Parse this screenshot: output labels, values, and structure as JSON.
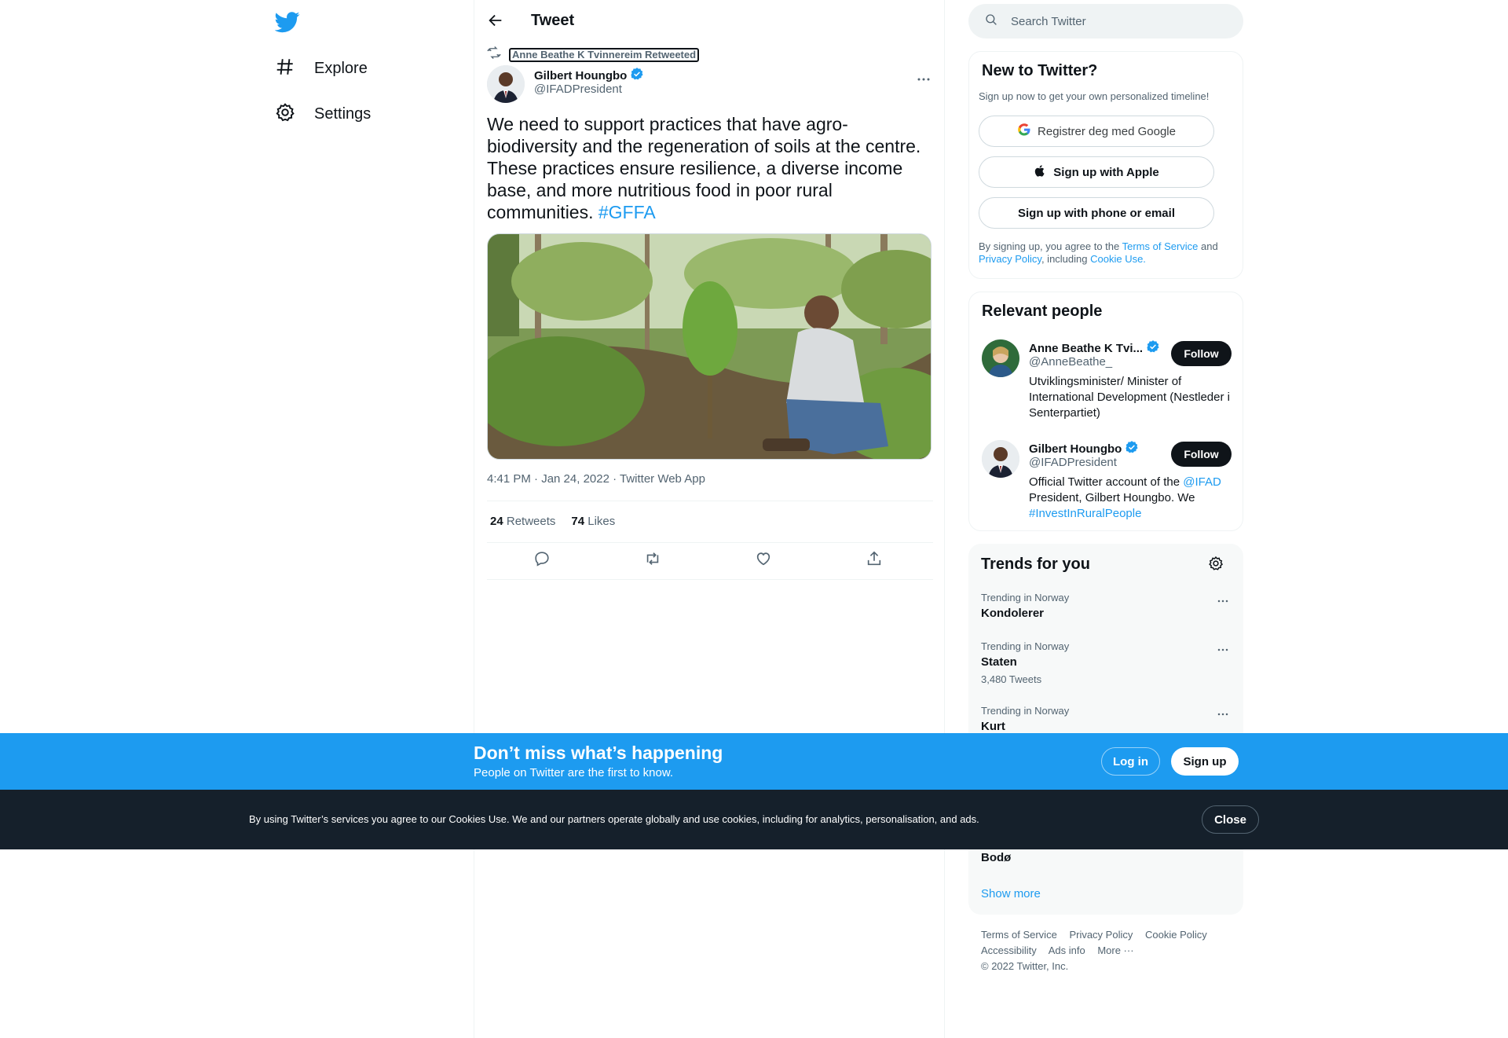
{
  "nav": {
    "items": [
      {
        "label": "Explore",
        "icon": "hashtag-icon"
      },
      {
        "label": "Settings",
        "icon": "gear-icon"
      }
    ]
  },
  "header": {
    "title": "Tweet"
  },
  "tweet": {
    "retweet_context": "Anne Beathe K Tvinnereim Retweeted",
    "author_name": "Gilbert Houngbo",
    "author_handle": "@IFADPresident",
    "text": "We need to support practices that have agro-biodiversity and the regeneration of soils at the centre. These practices ensure resilience, a diverse income base, and more nutritious food in poor rural communities.",
    "hashtag": "#GFFA",
    "meta": "4:41 PM · Jan 24, 2022 · Twitter Web App",
    "retweets_count": "24",
    "retweets_label": "Retweets",
    "likes_count": "74",
    "likes_label": "Likes"
  },
  "search": {
    "placeholder": "Search Twitter"
  },
  "new_to_twitter": {
    "title": "New to Twitter?",
    "subtitle": "Sign up now to get your own personalized timeline!",
    "google_label": "Registrer deg med Google",
    "apple_label": "Sign up with Apple",
    "phone_label": "Sign up with phone or email",
    "legal_prefix": "By signing up, you agree to the ",
    "terms": "Terms of Service",
    "and": " and ",
    "privacy": "Privacy Policy",
    "including": ", including ",
    "cookie": "Cookie Use."
  },
  "relevant": {
    "title": "Relevant people",
    "people": [
      {
        "name": "Anne Beathe K Tvi...",
        "handle": "@AnneBeathe_",
        "bio": "Utviklingsminister/ Minister of International Development (Nestleder i Senterpartiet)",
        "follow": "Follow"
      },
      {
        "name": "Gilbert Houngbo",
        "handle": "@IFADPresident",
        "bio_prefix": "Official Twitter account of the ",
        "bio_link": "@IFAD",
        "bio_middle": " President, Gilbert Houngbo. We ",
        "bio_tag": "#InvestInRuralPeople",
        "follow": "Follow"
      }
    ]
  },
  "trends": {
    "title": "Trends for you",
    "items": [
      {
        "category": "Trending in Norway",
        "name": "Kondolerer",
        "count": ""
      },
      {
        "category": "Trending in Norway",
        "name": "Staten",
        "count": "3,480 Tweets"
      },
      {
        "category": "Trending in Norway",
        "name": "Kurt",
        "count": ""
      },
      {
        "category": "",
        "name": "Bodø",
        "count": ""
      }
    ],
    "show_more": "Show more"
  },
  "footer": {
    "links_row1": [
      "Terms of Service",
      "Privacy Policy",
      "Cookie Policy"
    ],
    "links_row2": [
      "Accessibility",
      "Ads info",
      "More ···"
    ],
    "copyright": "© 2022 Twitter, Inc."
  },
  "signup_bar": {
    "title": "Don’t miss what’s happening",
    "subtitle": "People on Twitter are the first to know.",
    "login": "Log in",
    "signup": "Sign up"
  },
  "cookie_bar": {
    "text": "By using Twitter’s services you agree to our Cookies Use. We and our partners operate globally and use cookies, including for analytics, personalisation, and ads.",
    "close": "Close"
  },
  "colors": {
    "accent": "#1d9bf0",
    "text": "#0f1419",
    "muted": "#536471",
    "dark_bar": "#15202b"
  }
}
